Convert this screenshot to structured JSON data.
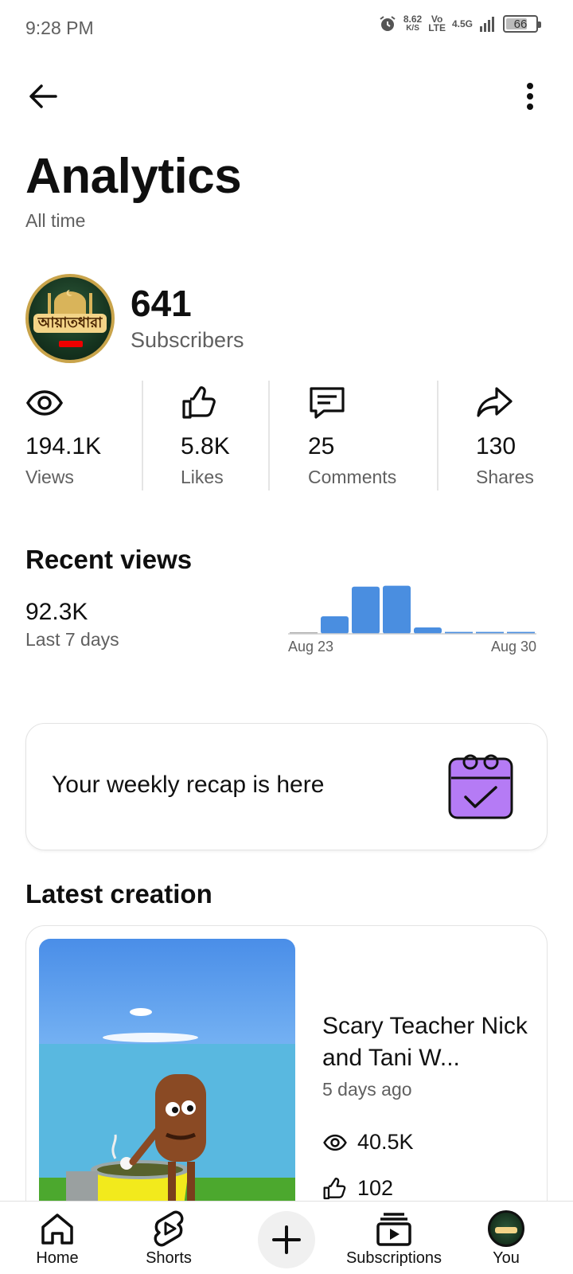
{
  "status_bar": {
    "time": "9:28 PM",
    "net_speed_top": "8.62",
    "net_speed_bottom": "K/S",
    "volte_top": "Vo",
    "volte_bottom": "LTE",
    "network": "4.5G",
    "battery": "66"
  },
  "header": {
    "title": "Analytics",
    "subtitle": "All time"
  },
  "channel": {
    "avatar_text": "আয়াতধারা",
    "subscribers_value": "641",
    "subscribers_label": "Subscribers"
  },
  "metrics": [
    {
      "icon": "eye-icon",
      "value": "194.1K",
      "label": "Views"
    },
    {
      "icon": "thumbs-up-icon",
      "value": "5.8K",
      "label": "Likes"
    },
    {
      "icon": "comment-icon",
      "value": "25",
      "label": "Comments"
    },
    {
      "icon": "share-icon",
      "value": "130",
      "label": "Shares"
    }
  ],
  "recent_views": {
    "title": "Recent views",
    "value": "92.3K",
    "period": "Last 7 days"
  },
  "chart_data": {
    "type": "bar",
    "title": "",
    "xlabel": "",
    "ylabel": "",
    "x_tick_labels": [
      "Aug 23",
      "Aug 30"
    ],
    "categories": [
      "Aug 23",
      "Aug 24",
      "Aug 25",
      "Aug 26",
      "Aug 27",
      "Aug 28",
      "Aug 29",
      "Aug 30"
    ],
    "values": [
      0.4,
      5.5,
      14.8,
      15.1,
      2.0,
      0.6,
      0.6,
      0.6
    ],
    "accent_color": "#4a8ee0",
    "baseline_color": "#b0b0b0",
    "ylim": [
      0,
      16
    ]
  },
  "recap": {
    "text": "Your weekly recap is here",
    "icon": "calendar-check-icon",
    "icon_color": "#b57bf5"
  },
  "latest_creation": {
    "title": "Latest creation",
    "video_title": "Scary Teacher Nick and Tani W...",
    "ago": "5 days ago",
    "views": "40.5K",
    "likes": "102"
  },
  "bottom_nav": {
    "home": "Home",
    "shorts": "Shorts",
    "subscriptions": "Subscriptions",
    "you": "You"
  }
}
